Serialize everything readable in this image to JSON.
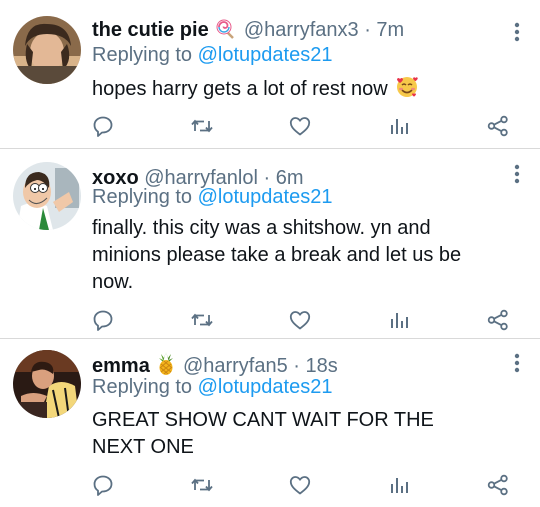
{
  "tweets": [
    {
      "name": "the cutie pie",
      "name_emoji": "lollipop-emoji",
      "handle": "@harryfanx3",
      "time": "· 7m",
      "replying_prefix": "Replying to",
      "replying_to": "@lotupdates21",
      "text": "hopes harry gets a lot of rest now",
      "text_emoji": "smiling-face-with-hearts-emoji"
    },
    {
      "name": "xoxo",
      "handle": "@harryfanlol",
      "time": "· 6m",
      "replying_prefix": "Replying to",
      "replying_to": "@lotupdates21",
      "text": "finally. this city was a shitshow. yn and minions please take a break and let us be now."
    },
    {
      "name": "emma",
      "name_emoji": "pineapple-emoji",
      "handle": "@harryfan5",
      "time": "· 18s",
      "replying_prefix": "Replying to",
      "replying_to": "@lotupdates21",
      "text": "GREAT SHOW CANT WAIT FOR THE NEXT ONE"
    }
  ],
  "icons": {
    "reply": "reply-icon",
    "retweet": "retweet-icon",
    "like": "like-icon",
    "analytics": "analytics-icon",
    "share": "share-icon",
    "more": "more-options-icon"
  },
  "colors": {
    "handle": "#5b7083",
    "mention": "#1d9bf0",
    "icon": "#5b7083",
    "divider": "#d9d9d9"
  }
}
